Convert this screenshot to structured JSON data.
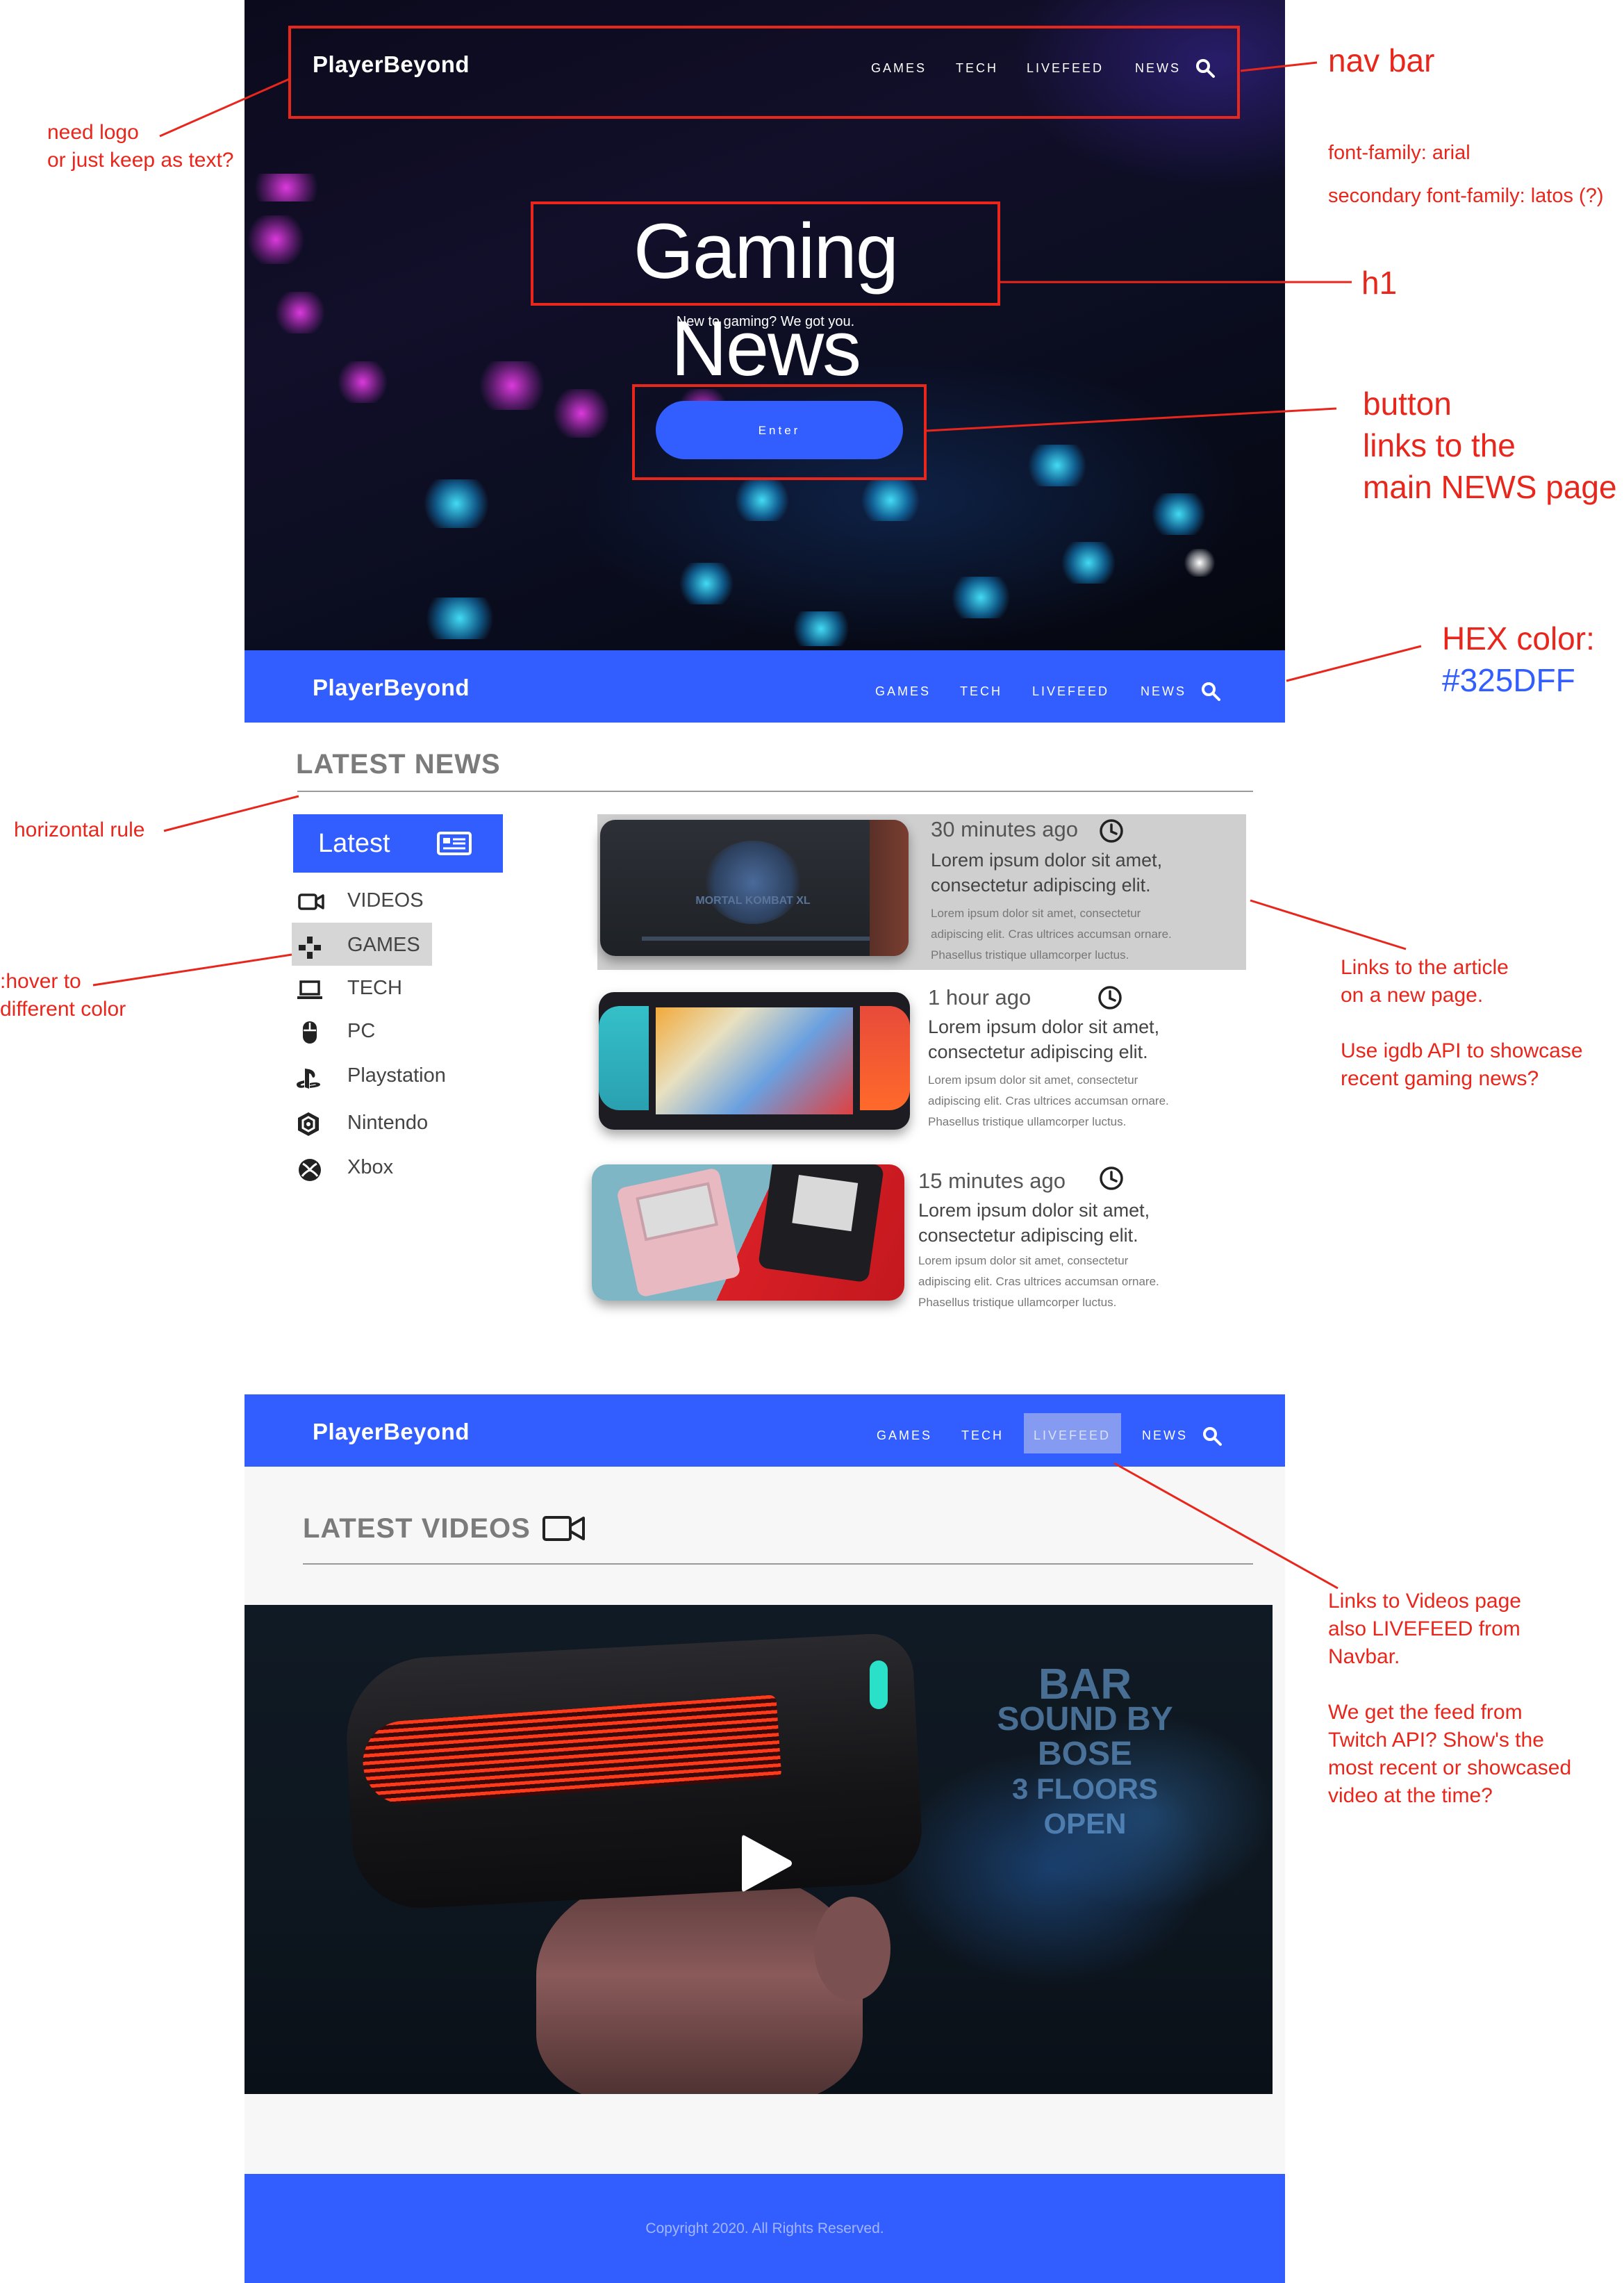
{
  "brand": "PlayerBeyond",
  "nav": {
    "games": "GAMES",
    "tech": "TECH",
    "livefeed": "LIVEFEED",
    "news": "NEWS"
  },
  "hero": {
    "title": "Gaming News",
    "subtitle": "New to gaming? We got you.",
    "button": "Enter"
  },
  "news": {
    "title": "LATEST NEWS",
    "tab": "Latest",
    "categories": [
      "VIDEOS",
      "GAMES",
      "TECH",
      "PC",
      "Playstation",
      "Nintendo",
      "Xbox"
    ],
    "articles": [
      {
        "time": "30 minutes ago",
        "headline1": "Lorem ipsum dolor sit amet,",
        "headline2": "consectetur adipiscing elit.",
        "body1": "Lorem ipsum dolor sit amet, consectetur",
        "body2": "adipiscing elit. Cras ultrices accumsan ornare.",
        "body3": "Phasellus tristique ullamcorper luctus.",
        "thumb_label": "MORTAL KOMBAT XL"
      },
      {
        "time": "1 hour ago",
        "headline1": "Lorem ipsum dolor sit amet,",
        "headline2": "consectetur adipiscing elit.",
        "body1": "Lorem ipsum dolor sit amet, consectetur",
        "body2": "adipiscing elit. Cras ultrices accumsan ornare.",
        "body3": "Phasellus tristique ullamcorper luctus."
      },
      {
        "time": "15 minutes ago",
        "headline1": "Lorem ipsum dolor sit amet,",
        "headline2": "consectetur adipiscing elit.",
        "body1": "Lorem ipsum dolor sit amet, consectetur",
        "body2": "adipiscing elit. Cras ultrices accumsan ornare.",
        "body3": "Phasellus tristique ullamcorper luctus."
      }
    ]
  },
  "videos": {
    "title": "LATEST VIDEOS",
    "neon1": "BAR",
    "neon2": "SOUND BY",
    "neon3": "BOSE",
    "neon4": "3 FLOORS",
    "neon5": "OPEN"
  },
  "footer": {
    "copyright": "Copyright 2020. All Rights Reserved."
  },
  "annotations": {
    "nav_bar": "nav bar",
    "logo1": "need logo",
    "logo2": "or just keep as text?",
    "font1": "font-family: arial",
    "font2": "secondary font-family: latos (?)",
    "h1": "h1",
    "button1": "button",
    "button2": "links to the",
    "button3": "main NEWS page",
    "hex1": "HEX color:",
    "hex2": "#325DFF",
    "hr": "horizontal rule",
    "hover1": ":hover to",
    "hover2": "different color",
    "links1": "Links to the article",
    "links2": "on a new page.",
    "links3": "Use igdb API to showcase",
    "links4": "recent gaming news?",
    "vid1": "Links to Videos page",
    "vid2": "also LIVEFEED from",
    "vid3": "Navbar.",
    "vid4": "We get the feed from",
    "vid5": "Twitch API? Show's the",
    "vid6": "most recent or showcased",
    "vid7": "video at the time?"
  },
  "colors": {
    "accent": "#325DFF",
    "annotation": "#e8261c"
  },
  "icons": [
    "search-icon",
    "newspaper-icon",
    "video-camera-icon",
    "gamepad-icon",
    "laptop-icon",
    "mouse-icon",
    "playstation-icon",
    "nintendo-icon",
    "xbox-icon",
    "clock-icon",
    "play-icon"
  ]
}
